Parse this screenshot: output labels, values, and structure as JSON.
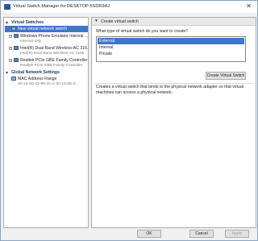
{
  "window": {
    "title": "Virtual Switch Manager for DESKTOP-5SDR9AJ"
  },
  "left_panel": {
    "virtual_switches_header": "Virtual Switches",
    "new_switch": "New virtual network switch",
    "switches": [
      {
        "name": "Windows Phone Emulator Internal ...",
        "detail": "Internal only"
      },
      {
        "name": "Intel(R) Dual Band Wireless-AC 316...",
        "detail": "Intel(R) Dual Band Wireless-AC 3165"
      },
      {
        "name": "Realtek PCIe GBE Family Controller ...",
        "detail": "Realtek PCIe GBE Family Controller"
      }
    ],
    "global_header": "Global Network Settings",
    "mac": {
      "name": "MAC Address Range",
      "detail": "00-15-5D-32-90-15 to 00-15-5D-3..."
    }
  },
  "right_panel": {
    "header": "Create virtual switch",
    "question": "What type of virtual switch do you want to create?",
    "options": [
      "External",
      "Internal",
      "Private"
    ],
    "selected": "External",
    "create_button": "Create Virtual Switch",
    "description": "Creates a virtual switch that binds to the physical network adapter so that virtual machines can access a physical network."
  },
  "footer": {
    "ok": "OK",
    "cancel": "Cancel",
    "apply": "Apply"
  }
}
